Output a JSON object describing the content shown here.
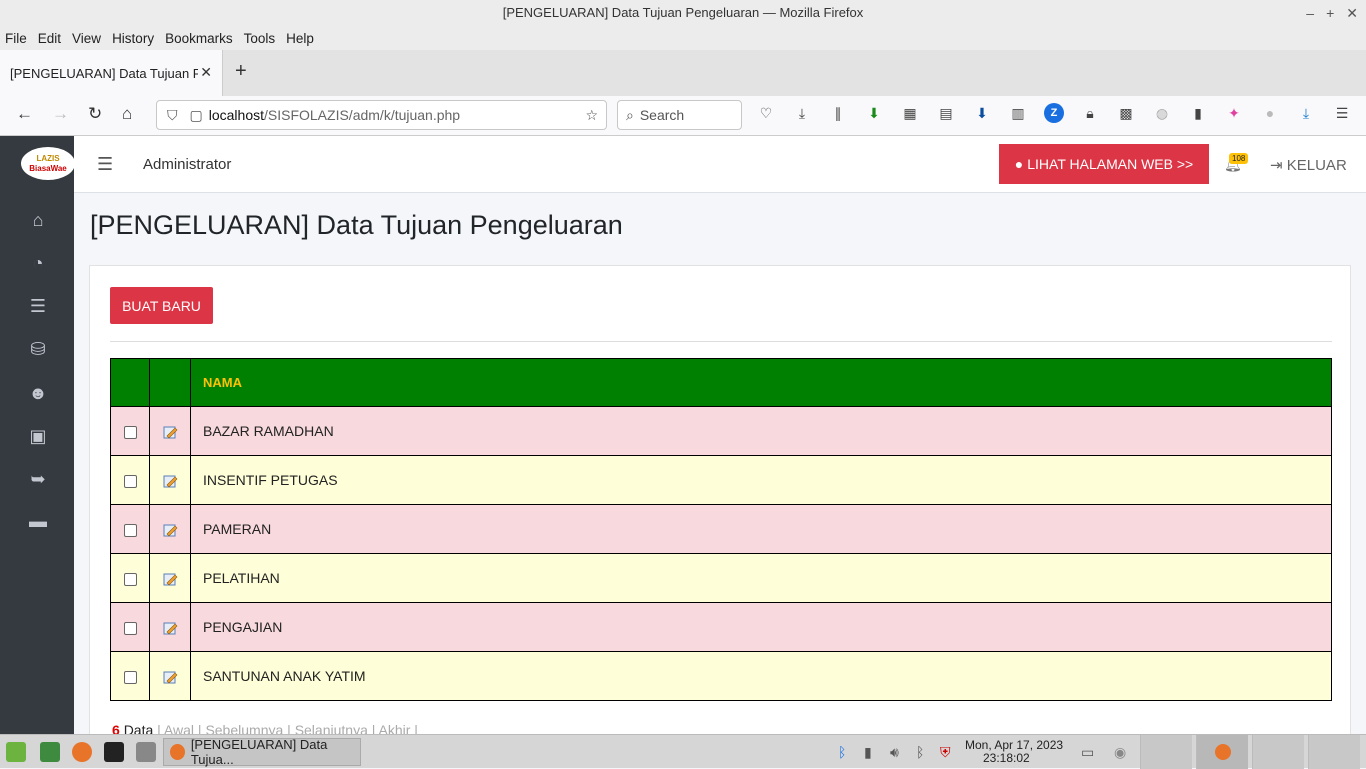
{
  "window": {
    "title": "[PENGELUARAN] Data Tujuan Pengeluaran — Mozilla Firefox"
  },
  "menu": [
    "File",
    "Edit",
    "View",
    "History",
    "Bookmarks",
    "Tools",
    "Help"
  ],
  "tab": {
    "label": "[PENGELUARAN] Data Tujuan Pen"
  },
  "url": {
    "host": "localhost",
    "path": "/SISFOLAZIS/adm/k/tujuan.php"
  },
  "search": {
    "placeholder": "Search"
  },
  "logo": {
    "line1": "LAZIS",
    "line2": "BiasaWae"
  },
  "header": {
    "admin": "Administrator",
    "web_button": "LIHAT HALAMAN WEB >>",
    "badge": "108",
    "logout": "KELUAR"
  },
  "page": {
    "title": "[PENGELUARAN] Data Tujuan Pengeluaran",
    "new_button": "BUAT BARU"
  },
  "table": {
    "column": "NAMA",
    "rows": [
      "BAZAR RAMADHAN",
      "INSENTIF PETUGAS",
      "PAMERAN",
      "PELATIHAN",
      "PENGAJIAN",
      "SANTUNAN ANAK YATIM"
    ]
  },
  "pager": {
    "count": "6",
    "data_label": "Data",
    "first": "Awal",
    "prev": "Sebelumnya",
    "next": "Selanjutnya",
    "last": "Akhir"
  },
  "taskbar": {
    "window_label": "[PENGELUARAN] Data Tujua...",
    "date": "Mon, Apr 17, 2023",
    "time": "23:18:02"
  },
  "colors": {
    "sidebar": "#343a40",
    "danger": "#dc3545",
    "table_header": "#008000",
    "row_pink": "#f8d9de",
    "row_yellow": "#fefed8"
  }
}
